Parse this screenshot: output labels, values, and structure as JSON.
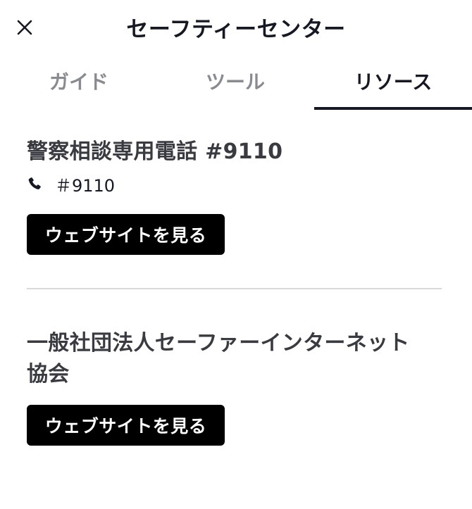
{
  "header": {
    "title": "セーフティーセンター",
    "close_icon": "close-icon"
  },
  "tabs": [
    {
      "label": "ガイド",
      "active": false
    },
    {
      "label": "ツール",
      "active": false
    },
    {
      "label": "リソース",
      "active": true
    }
  ],
  "resources": [
    {
      "title": "警察相談専用電話 #9110",
      "phone": "＃9110",
      "phone_icon": "phone-icon",
      "button_label": "ウェブサイトを見る"
    },
    {
      "title_line1": "一般社団法人セーファーインターネット",
      "title_line2": "協会",
      "button_label": "ウェブサイトを見る"
    }
  ],
  "colors": {
    "text_primary": "#161823",
    "text_inactive": "#8a8b91",
    "button_bg": "#000000",
    "divider": "#d9d9db"
  }
}
